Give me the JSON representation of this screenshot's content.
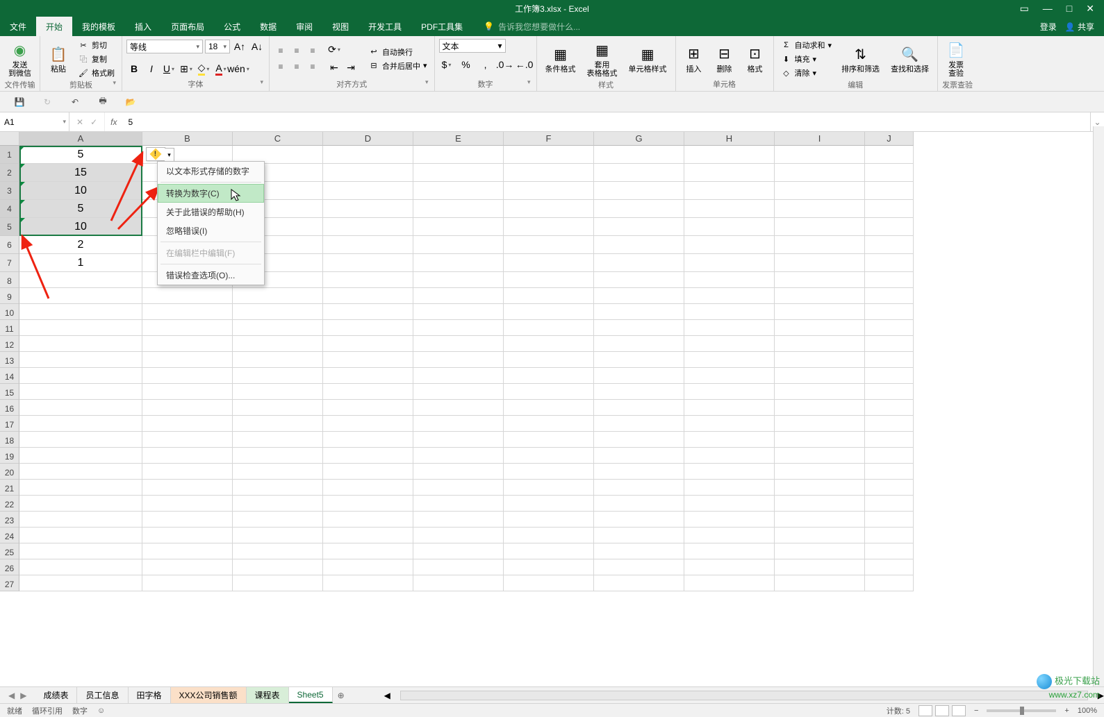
{
  "title": "工作簿3.xlsx - Excel",
  "tabs": [
    "文件",
    "开始",
    "我的模板",
    "插入",
    "页面布局",
    "公式",
    "数据",
    "审阅",
    "视图",
    "开发工具",
    "PDF工具集"
  ],
  "active_tab_index": 1,
  "tell_me_placeholder": "告诉我您想要做什么...",
  "login": "登录",
  "share": "共享",
  "ribbon": {
    "file_transfer": {
      "btn": "发送\n到微信",
      "label": "文件传输"
    },
    "clipboard": {
      "paste": "粘贴",
      "cut": "剪切",
      "copy": "复制",
      "format_painter": "格式刷",
      "label": "剪贴板"
    },
    "font": {
      "name": "等线",
      "size": "18",
      "label": "字体"
    },
    "alignment": {
      "wrap": "自动换行",
      "merge": "合并后居中",
      "label": "对齐方式"
    },
    "number": {
      "format": "文本",
      "label": "数字"
    },
    "styles": {
      "cond": "条件格式",
      "table": "套用\n表格格式",
      "cell": "单元格样式",
      "label": "样式"
    },
    "cells": {
      "insert": "插入",
      "delete": "删除",
      "format": "格式",
      "label": "单元格"
    },
    "editing": {
      "autosum": "自动求和",
      "fill": "填充",
      "clear": "清除",
      "sort": "排序和筛选",
      "find": "查找和选择",
      "label": "编辑"
    },
    "invoice": {
      "btn": "发票\n查验",
      "label": "发票查验"
    }
  },
  "name_box": "A1",
  "formula_value": "5",
  "columns": [
    "A",
    "B",
    "C",
    "D",
    "E",
    "F",
    "G",
    "H",
    "I",
    "J"
  ],
  "row_count": 27,
  "data_cells": {
    "A1": "5",
    "A2": "15",
    "A3": "10",
    "A4": "5",
    "A5": "10",
    "A6": "2",
    "A7": "1"
  },
  "text_stored_rows": [
    1,
    2,
    3,
    4,
    5
  ],
  "selection": {
    "from": "A1",
    "to": "A5",
    "active": "A1"
  },
  "error_menu": {
    "items": [
      {
        "label": "以文本形式存储的数字",
        "disabled": false
      },
      {
        "label": "转换为数字(C)",
        "hover": true
      },
      {
        "label": "关于此错误的帮助(H)"
      },
      {
        "label": "忽略错误(I)"
      },
      {
        "label": "在编辑栏中编辑(F)",
        "disabled": true
      },
      {
        "label": "错误检查选项(O)..."
      }
    ],
    "sep_after": [
      0,
      3,
      4
    ]
  },
  "sheet_tabs": [
    {
      "name": "成绩表"
    },
    {
      "name": "员工信息"
    },
    {
      "name": "田字格"
    },
    {
      "name": "XXX公司销售额",
      "cls": "colored1"
    },
    {
      "name": "课程表",
      "cls": "colored2"
    },
    {
      "name": "Sheet5",
      "active": true
    }
  ],
  "status": {
    "ready": "就绪",
    "circular": "循环引用",
    "numlock": "数字",
    "count_label": "计数:",
    "count": "5",
    "zoom": "100%"
  },
  "watermark": {
    "brand": "极光下载站",
    "url": "www.xz7.com"
  }
}
